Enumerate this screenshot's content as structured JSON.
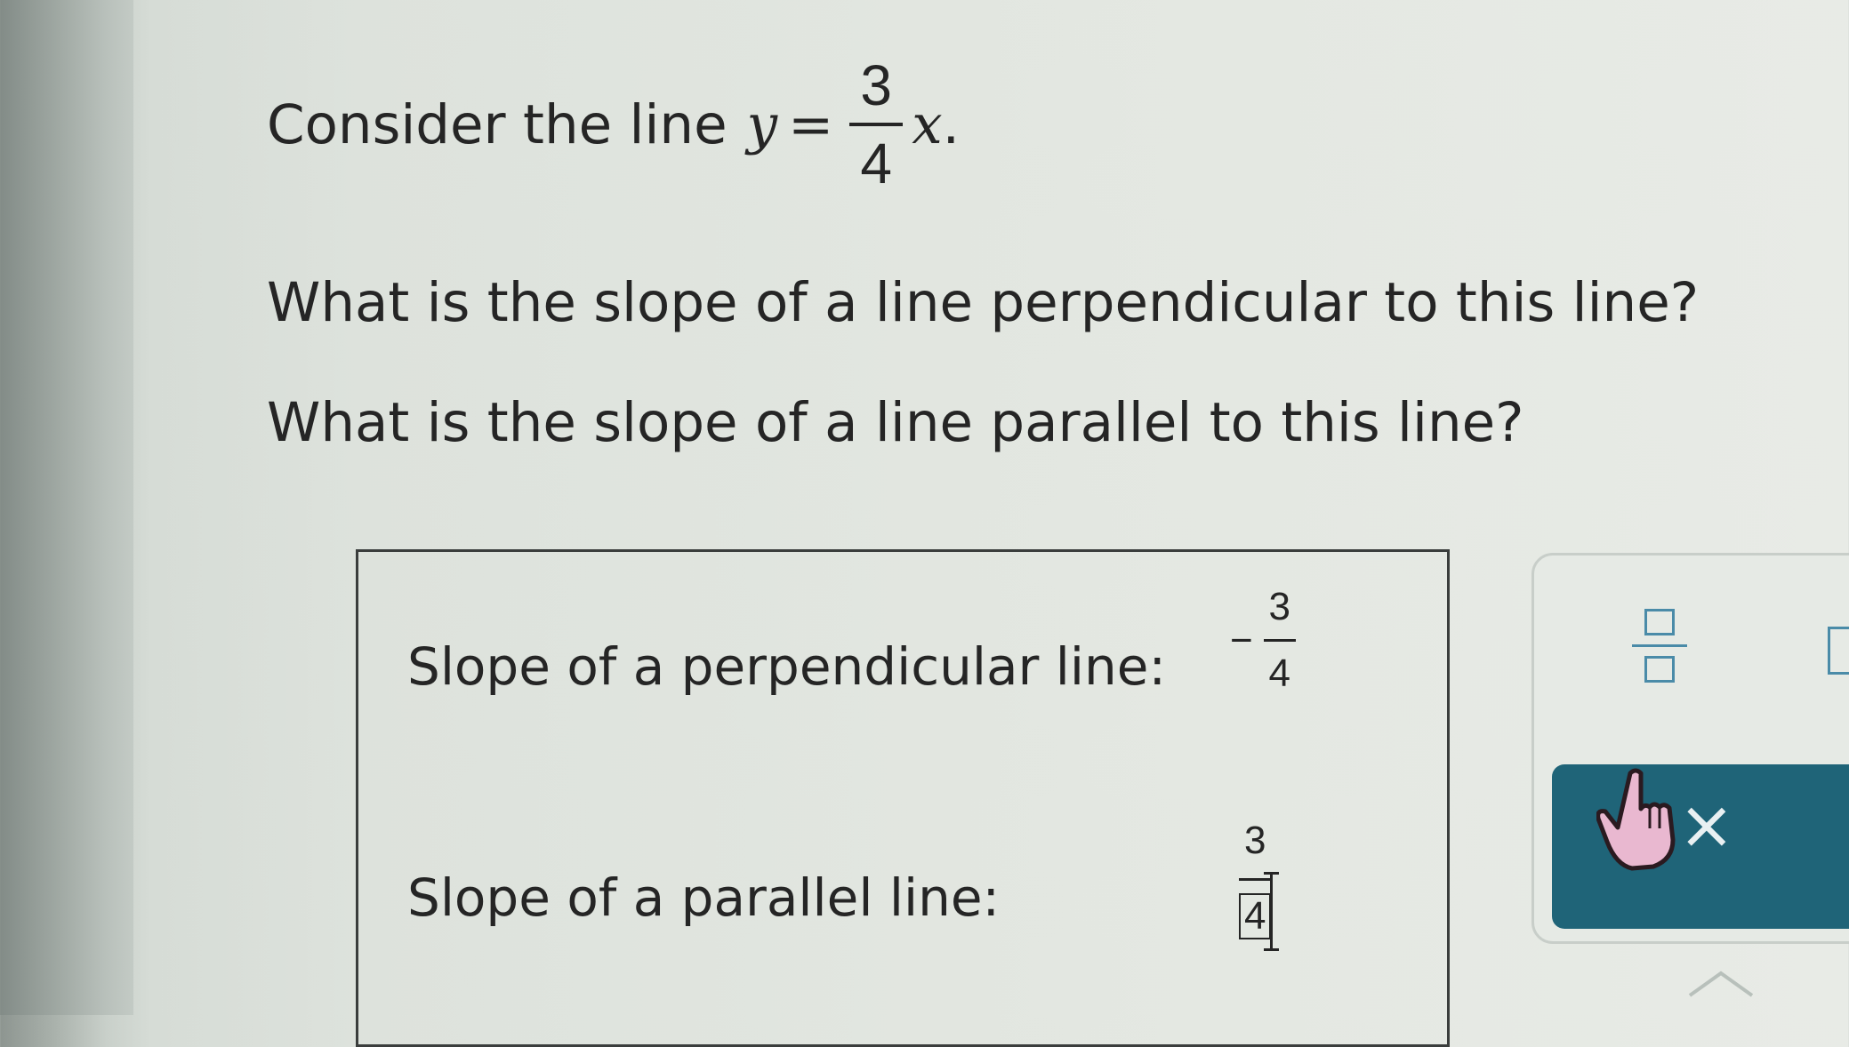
{
  "question": {
    "intro": "Consider the line",
    "equation": {
      "lhs": "y",
      "equals": "=",
      "numerator": "3",
      "denominator": "4",
      "variable": "x",
      "period": "."
    },
    "perpendicular_prompt": "What is the slope of a line perpendicular to this line?",
    "parallel_prompt": "What is the slope of a line parallel to this line?"
  },
  "answers": {
    "perpendicular_label": "Slope of a perpendicular line:",
    "perpendicular_value": {
      "sign": "−",
      "numerator": "3",
      "denominator": "4"
    },
    "parallel_label": "Slope of a parallel line:",
    "parallel_value": {
      "numerator": "3",
      "denominator": "4"
    }
  },
  "toolbar": {
    "fraction_tool_icon": "fraction-template-icon",
    "clear_label": "×"
  },
  "colors": {
    "accent": "#1f6478",
    "tool_icon": "#4a8ba8",
    "cursor_pink": "#e9b8d0"
  }
}
